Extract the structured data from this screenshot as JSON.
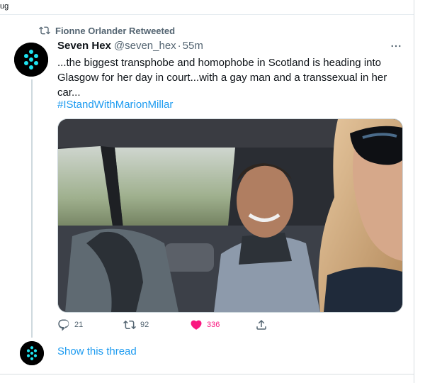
{
  "page": {
    "header_fragment": "ug"
  },
  "retweet": {
    "label": "Fionne Orlander Retweeted",
    "icon": "retweet-icon"
  },
  "tweet": {
    "display_name": "Seven Hex",
    "handle": "@seven_hex",
    "separator": "·",
    "time": "55m",
    "text": "...the biggest transphobe and homophobe in Scotland is heading into Glasgow for her day in court...with a gay man and a transsexual in her car...",
    "hashtag": "#IStandWithMarionMillar",
    "photo": {
      "description_icon": "car-selfie-photo"
    },
    "actions": {
      "replies": "21",
      "retweets": "92",
      "likes": "336"
    }
  },
  "thread": {
    "show_label": "Show this thread"
  },
  "colors": {
    "link": "#1d9bf0",
    "muted": "#536471",
    "like_active": "#f91880",
    "avatar_bg": "#000000",
    "avatar_dots": "#1ee3f0"
  }
}
